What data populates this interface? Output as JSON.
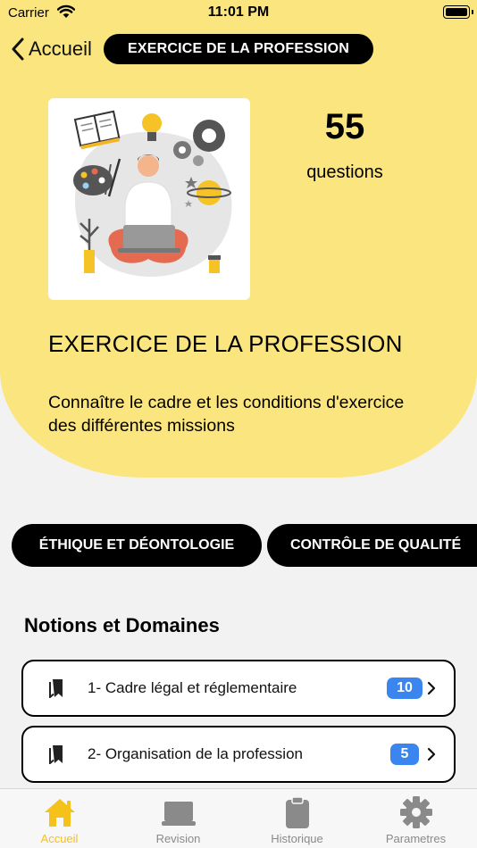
{
  "status_bar": {
    "carrier": "Carrier",
    "time": "11:01 PM"
  },
  "nav": {
    "back_label": "Accueil",
    "title": "EXERCICE DE LA PROFESSION"
  },
  "hero": {
    "question_count": "55",
    "question_label": "questions",
    "title": "EXERCICE DE LA PROFESSION",
    "description": "Connaître le cadre et les conditions d'exercice des différentes missions"
  },
  "chips": [
    {
      "label": "ÉTHIQUE ET DÉONTOLOGIE"
    },
    {
      "label": "CONTRÔLE DE QUALITÉ"
    }
  ],
  "notions": {
    "heading": "Notions et Domaines",
    "items": [
      {
        "label": "1- Cadre légal et réglementaire",
        "count": "10"
      },
      {
        "label": "2- Organisation de la profession",
        "count": "5"
      }
    ]
  },
  "tabs": [
    {
      "label": "Accueil",
      "icon": "home-icon",
      "active": true
    },
    {
      "label": "Revision",
      "icon": "laptop-icon",
      "active": false
    },
    {
      "label": "Historique",
      "icon": "clipboard-icon",
      "active": false
    },
    {
      "label": "Parametres",
      "icon": "gear-icon",
      "active": false
    }
  ],
  "colors": {
    "accent_yellow": "#fae57e",
    "tab_active": "#f4c21b",
    "badge_blue": "#3a86ee"
  }
}
